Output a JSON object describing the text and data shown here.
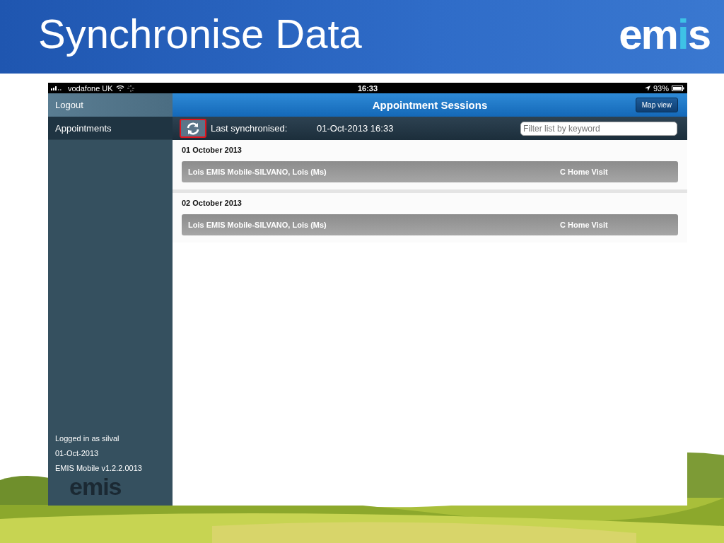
{
  "slide": {
    "title": "Synchronise Data",
    "logo": [
      {
        "text": "em",
        "accent": false
      },
      {
        "text": "i",
        "accent": true
      },
      {
        "text": "s",
        "accent": false
      }
    ]
  },
  "status_bar": {
    "carrier": "vodafone UK",
    "time": "16:33",
    "battery": "93%"
  },
  "sidebar": {
    "logout": "Logout",
    "items": [
      {
        "label": "Appointments",
        "selected": true
      }
    ],
    "footer": [
      "Logged in as silval",
      "01-Oct-2013",
      "EMIS Mobile v1.2.2.0013"
    ],
    "logo": "emis"
  },
  "navbar": {
    "title": "Appointment Sessions",
    "button": "Map view"
  },
  "toolbar": {
    "label": "Last synchronised:",
    "value": "01-Oct-2013 16:33",
    "filter": {
      "placeholder": "Filter list by keyword"
    }
  },
  "sessions": [
    {
      "date": "01 October 2013",
      "appointments": [
        {
          "patient": "Lois EMIS Mobile-SILVANO, Lois (Ms)",
          "type": "C Home Visit"
        }
      ]
    },
    {
      "date": "02 October 2013",
      "appointments": [
        {
          "patient": "Lois EMIS Mobile-SILVANO, Lois (Ms)",
          "type": "C Home Visit"
        }
      ]
    }
  ]
}
